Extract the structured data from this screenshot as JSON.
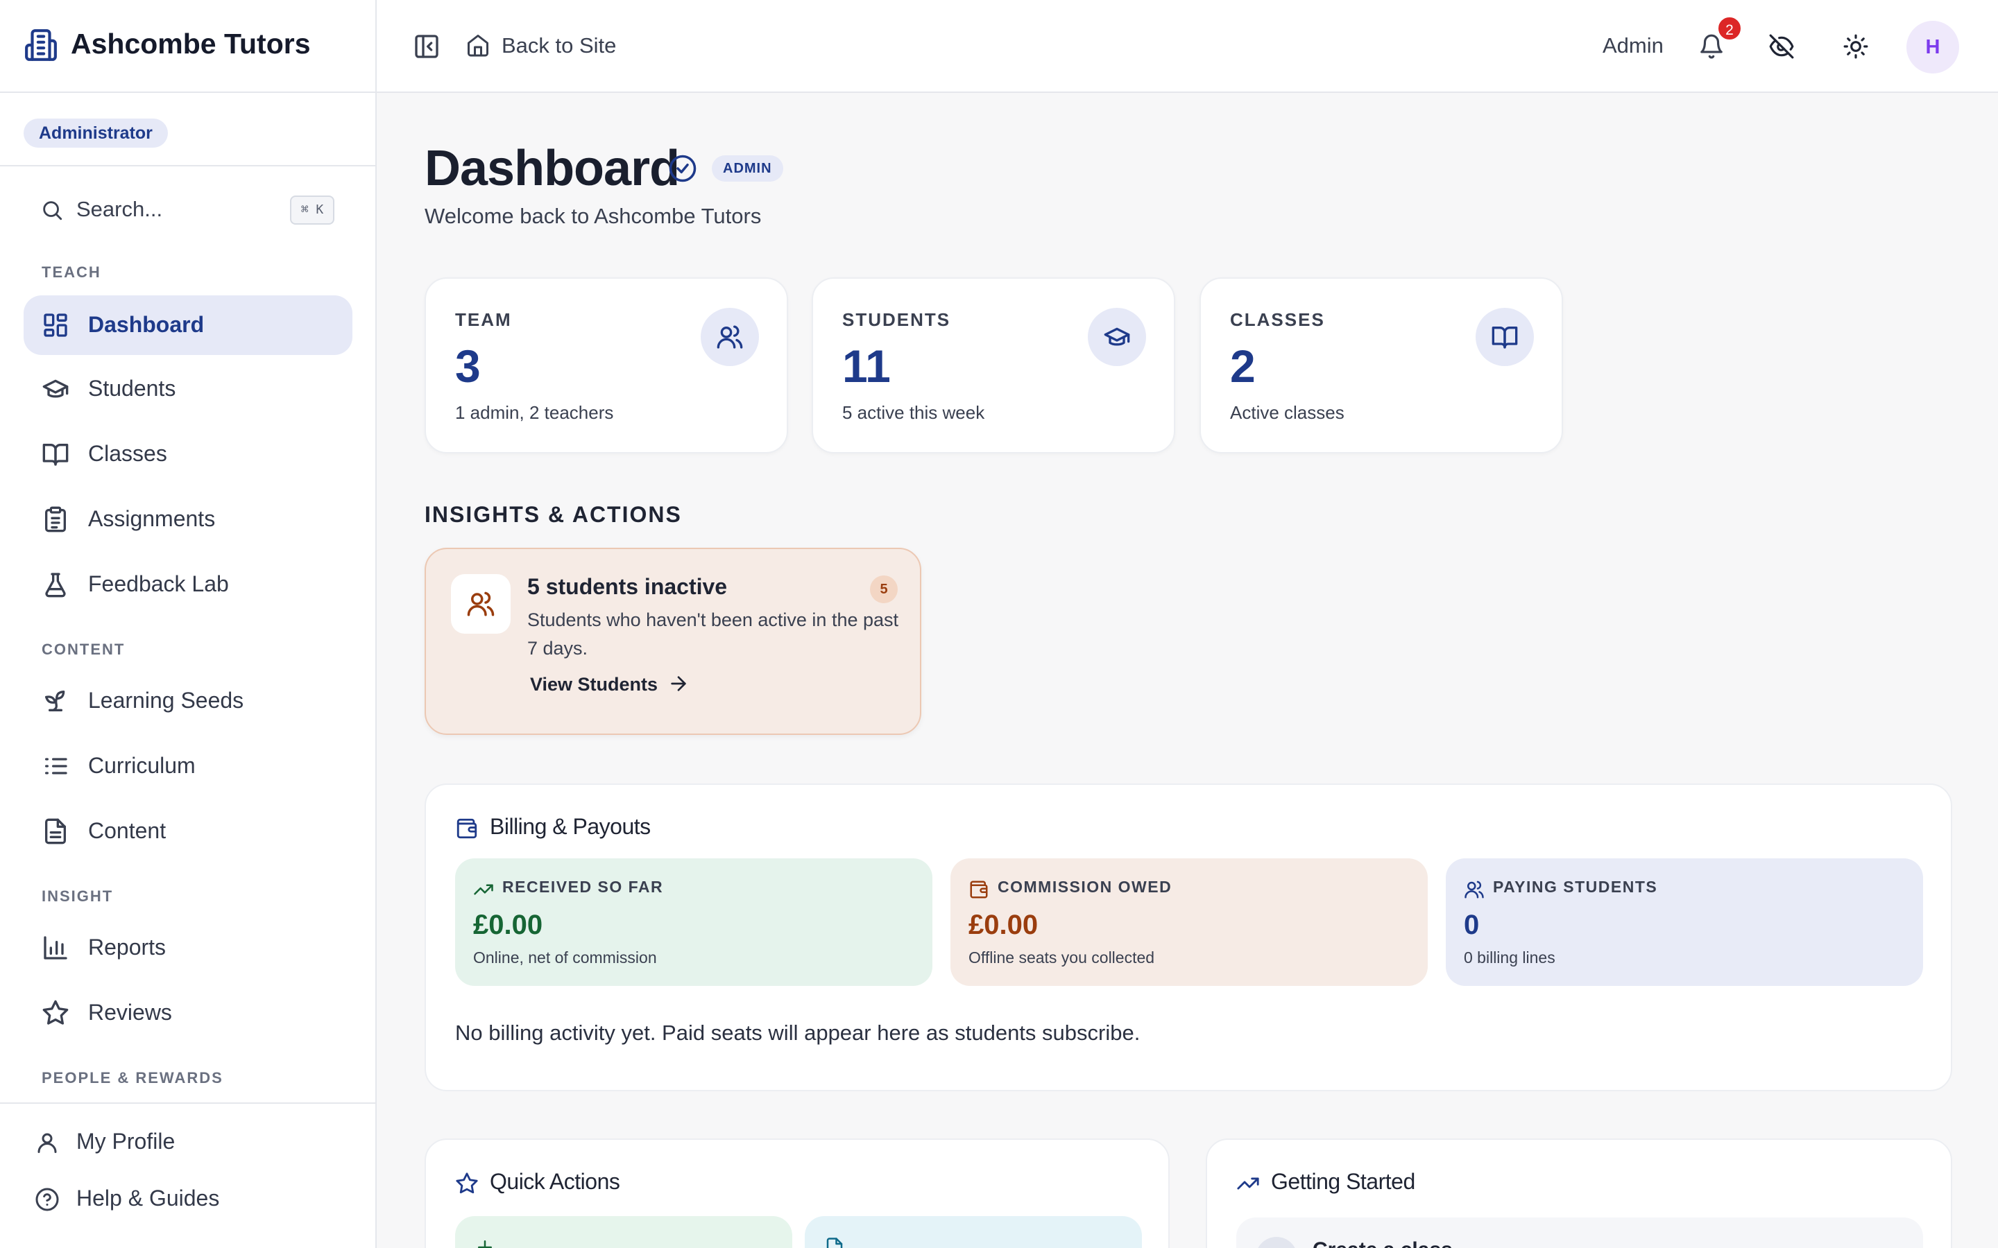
{
  "app": {
    "name": "Ashcombe Tutors",
    "role": "Administrator"
  },
  "sidebar": {
    "search_placeholder": "Search...",
    "search_shortcut": "⌘ K",
    "sections": {
      "teach": "TEACH",
      "content": "CONTENT",
      "insight": "INSIGHT",
      "people": "PEOPLE & REWARDS"
    },
    "items": [
      {
        "label": "Dashboard",
        "icon": "dashboard-icon",
        "active": true
      },
      {
        "label": "Students",
        "icon": "graduation-cap-icon"
      },
      {
        "label": "Classes",
        "icon": "book-icon"
      },
      {
        "label": "Assignments",
        "icon": "clipboard-icon"
      },
      {
        "label": "Feedback Lab",
        "icon": "flask-icon"
      },
      {
        "label": "Learning Seeds",
        "icon": "sprout-icon"
      },
      {
        "label": "Curriculum",
        "icon": "list-icon"
      },
      {
        "label": "Content",
        "icon": "file-icon"
      },
      {
        "label": "Reports",
        "icon": "bar-chart-icon"
      },
      {
        "label": "Reviews",
        "icon": "star-icon"
      }
    ],
    "footer": [
      {
        "label": "My Profile",
        "icon": "user-icon"
      },
      {
        "label": "Help & Guides",
        "icon": "help-icon"
      }
    ]
  },
  "topbar": {
    "back_label": "Back to Site",
    "user_label": "Admin",
    "notification_count": "2",
    "avatar_initial": "H"
  },
  "header": {
    "title": "Dashboard",
    "badge": "ADMIN",
    "subtitle": "Welcome back to Ashcombe Tutors"
  },
  "stats": [
    {
      "label": "TEAM",
      "value": "3",
      "sub": "1 admin, 2 teachers",
      "icon": "users-icon"
    },
    {
      "label": "STUDENTS",
      "value": "11",
      "sub": "5 active this week",
      "icon": "graduation-cap-icon"
    },
    {
      "label": "CLASSES",
      "value": "2",
      "sub": "Active classes",
      "icon": "book-icon"
    }
  ],
  "insights": {
    "section_title": "INSIGHTS & ACTIONS",
    "card": {
      "title": "5 students inactive",
      "count": "5",
      "description": "Students who haven't been active in the past 7 days.",
      "link": "View Students"
    }
  },
  "billing": {
    "title": "Billing & Payouts",
    "tiles": [
      {
        "label": "RECEIVED SO FAR",
        "value": "£0.00",
        "sub": "Online, net of commission",
        "icon": "trending-up-icon",
        "color": "#166534",
        "bg": "#e5f3ec"
      },
      {
        "label": "COMMISSION OWED",
        "value": "£0.00",
        "sub": "Offline seats you collected",
        "icon": "wallet-icon",
        "color": "#9a3d0e",
        "bg": "#f6ebe5"
      },
      {
        "label": "PAYING STUDENTS",
        "value": "0",
        "sub": "0 billing lines",
        "icon": "users-icon",
        "color": "#1e3a8a",
        "bg": "#e8ebf7"
      }
    ],
    "note": "No billing activity yet. Paid seats will appear here as students subscribe."
  },
  "quick_actions": {
    "title": "Quick Actions"
  },
  "getting_started": {
    "title": "Getting Started",
    "first_item": "Create a class"
  }
}
